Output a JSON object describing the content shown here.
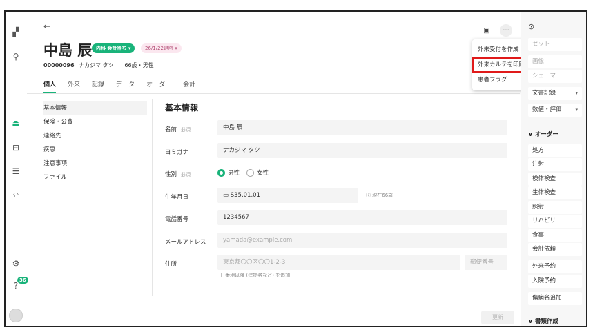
{
  "header": {
    "back_icon": "←",
    "patient_name": "中島 辰",
    "status_tag": "内科 会計待ち ▾",
    "discharge_tag": "26/1/22退院 ▾",
    "patient_id": "00000096",
    "kana": "ナカジマ タツ",
    "age_sex": "66歳・男性",
    "more_icon": "···",
    "id_icon": "▣"
  },
  "tabs": [
    "個人",
    "外来",
    "記録",
    "データ",
    "オーダー",
    "会計"
  ],
  "subnav": [
    "基本情報",
    "保険・公費",
    "連絡先",
    "疾患",
    "注意事項",
    "ファイル"
  ],
  "form": {
    "title": "基本情報",
    "name_label": "名前",
    "required": "必須",
    "name_value": "中島 辰",
    "kana_label": "ヨミガナ",
    "kana_value": "ナカジマ タツ",
    "sex_label": "性別",
    "male": "男性",
    "female": "女性",
    "dob_label": "生年月日",
    "dob_value": "S35.01.01",
    "age_note": "現在66歳",
    "phone_label": "電話番号",
    "phone_value": "1234567",
    "email_label": "メールアドレス",
    "email_placeholder": "yamada@example.com",
    "address_label": "住所",
    "address_placeholder": "東京都〇〇区〇〇1-2-3",
    "zip_placeholder": "郵便番号",
    "address_hint": "＋ 番地以降 (建物名など) を追加",
    "update_button": "更新"
  },
  "menu": [
    "外来受付を作成",
    "外来カルテを印刷",
    "患者フラグ"
  ],
  "right_panel": {
    "set": "セット",
    "image": "画像",
    "schema": "シェーマ",
    "doc_record": "文書記録",
    "values": "数値・評価",
    "order_section": "∨ オーダー",
    "orders": [
      "処方",
      "注射",
      "検体検査",
      "生体検査",
      "照射",
      "リハビリ",
      "食事",
      "会計依頼"
    ],
    "outpatient": "外来予約",
    "inpatient": "入院予約",
    "disease_add": "傷病名追加",
    "docs_section": "∨ 書類作成"
  },
  "rail": {
    "notification_count": "36"
  },
  "colors": {
    "accent": "#19b37a",
    "highlight": "#e01a1a"
  }
}
